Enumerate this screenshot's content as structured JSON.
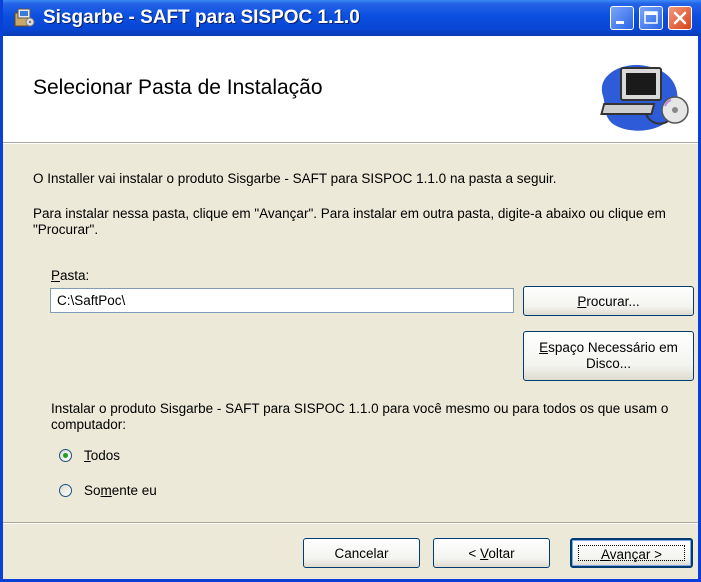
{
  "window": {
    "title": "Sisgarbe - SAFT para SISPOC 1.1.0",
    "icon": "installer-icon",
    "controls": {
      "minimize": "minimize-icon",
      "maximize": "maximize-icon",
      "close": "close-icon"
    }
  },
  "banner": {
    "title": "Selecionar Pasta de Instalação",
    "art": "computer-disc-icon"
  },
  "body": {
    "intro": "O Installer vai instalar o produto Sisgarbe - SAFT para SISPOC 1.1.0 na pasta a seguir.",
    "instructions": "Para instalar nessa pasta, clique em \"Avançar\". Para instalar em outra pasta, digite-a abaixo ou clique em \"Procurar\".",
    "folder_label_accel": "P",
    "folder_label_rest": "asta:",
    "folder_value": "C:\\SaftPoc\\",
    "browse_accel": "P",
    "browse_rest": "rocurar...",
    "disk_space_accel": "E",
    "disk_space_rest": "spaço Necessário em",
    "disk_space_line2": "Disco...",
    "scope_question": "Instalar o produto Sisgarbe - SAFT para SISPOC 1.1.0 para você mesmo ou para todos os que usam o computador:",
    "scope_options": [
      {
        "accel": "T",
        "rest": "odos",
        "selected": true
      },
      {
        "pre": "So",
        "accel": "m",
        "rest": "ente eu",
        "selected": false
      }
    ]
  },
  "footer": {
    "cancel": "Cancelar",
    "back_pre": "< ",
    "back_accel": "V",
    "back_rest": "oltar",
    "next_accel": "A",
    "next_rest": "vançar >"
  },
  "colors": {
    "titlebar": "#0846d4",
    "face": "#ece9d8",
    "radio_dot": "#21a121",
    "close_button": "#d8421a"
  }
}
